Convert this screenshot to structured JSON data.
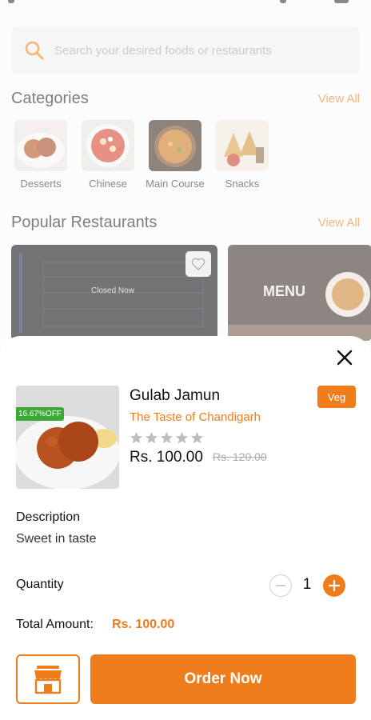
{
  "search": {
    "placeholder": "Search your desired foods or restaurants"
  },
  "categories_section": {
    "title": "Categories",
    "view_all": "View All",
    "items": [
      {
        "label": "Desserts"
      },
      {
        "label": "Chinese"
      },
      {
        "label": "Main Course"
      },
      {
        "label": "Snacks"
      }
    ]
  },
  "restaurants_section": {
    "title": "Popular Restaurants",
    "view_all": "View All",
    "cards": [
      {
        "status": "Closed Now"
      },
      {
        "menu_text": "MENU"
      }
    ]
  },
  "product_sheet": {
    "name": "Gulab Jamun",
    "restaurant": "The Taste of Chandigarh",
    "discount_badge": "16.67%OFF",
    "veg_label": "Veg",
    "rating": 0,
    "rating_max": 5,
    "price": "Rs. 100.00",
    "old_price": "Rs. 120.00",
    "description_heading": "Description",
    "description": "Sweet in taste",
    "quantity_label": "Quantity",
    "quantity": "1",
    "total_label": "Total Amount:",
    "total_value": "Rs. 100.00",
    "order_button": "Order Now"
  },
  "colors": {
    "accent": "#ef7d1c",
    "discount_green": "#3aa935",
    "star_empty": "#bdbdbd"
  },
  "icons": {
    "search": "search-icon",
    "close": "close-icon",
    "favorite": "heart-icon",
    "store": "store-icon",
    "minus": "minus-icon",
    "plus": "plus-icon",
    "star": "star-icon"
  }
}
